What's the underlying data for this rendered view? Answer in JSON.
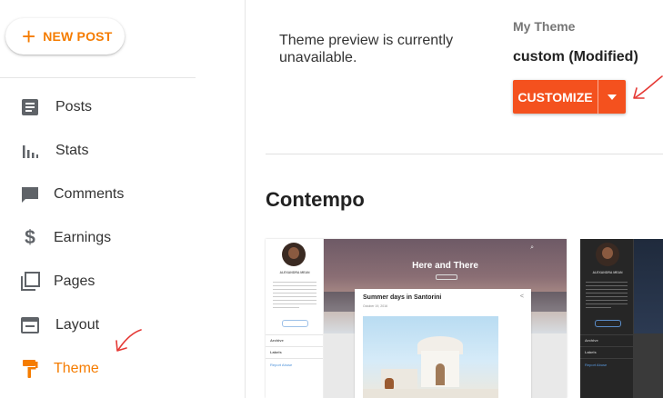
{
  "sidebar": {
    "new_post_label": "NEW POST",
    "items": [
      {
        "label": "Posts",
        "icon": "posts-icon"
      },
      {
        "label": "Stats",
        "icon": "stats-icon"
      },
      {
        "label": "Comments",
        "icon": "comments-icon"
      },
      {
        "label": "Earnings",
        "icon": "earnings-icon"
      },
      {
        "label": "Pages",
        "icon": "pages-icon"
      },
      {
        "label": "Layout",
        "icon": "layout-icon"
      },
      {
        "label": "Theme",
        "icon": "theme-icon",
        "active": true
      }
    ]
  },
  "main": {
    "preview_unavailable": "Theme preview is currently unavailable.",
    "my_theme_label": "My Theme",
    "current_theme_name": "custom (Modified)",
    "customize_label": "CUSTOMIZE",
    "section_title": "Contempo",
    "thumbnails": [
      {
        "blog_title": "Here and There",
        "post_title": "Summer days in Santorini",
        "post_date": "October 19, 2016",
        "profile_name": "ALEXANDRA MEAN",
        "menu_items": [
          "Archive",
          "Labels",
          "Report Abuse"
        ]
      },
      {
        "profile_name": "ALEXANDRA MEAN",
        "menu_items": [
          "Archive",
          "Labels",
          "Report Abuse"
        ]
      }
    ]
  },
  "colors": {
    "accent": "#f57c00",
    "customize_button": "#f4511e",
    "annotation_arrow": "#e53935"
  }
}
